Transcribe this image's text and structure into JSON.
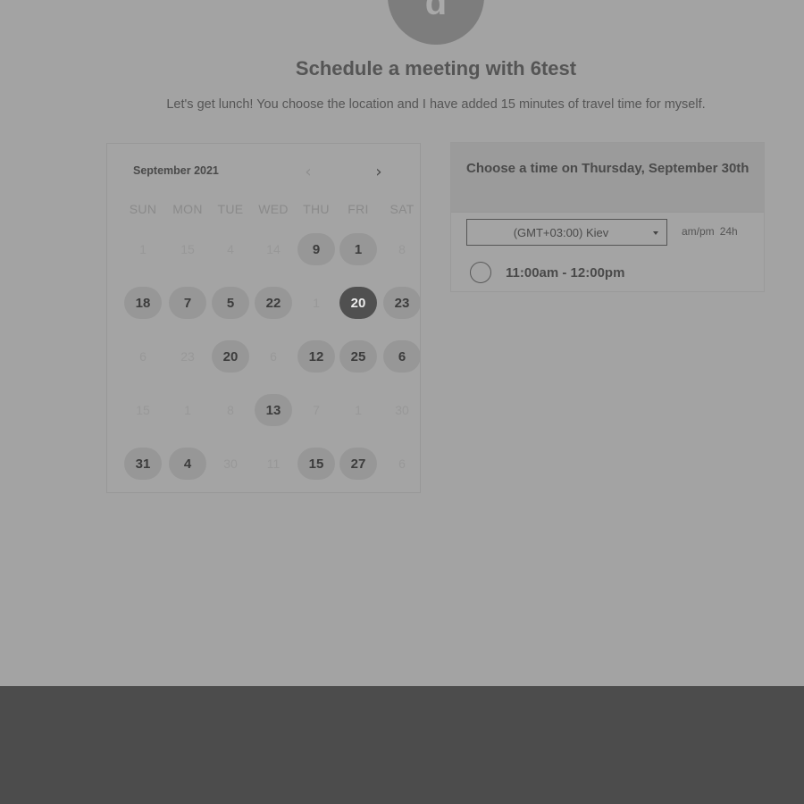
{
  "host": {
    "avatar_letter": "d",
    "title": "Schedule a meeting with 6test",
    "description": "Let's get lunch! You choose the location and I have added 15 minutes of travel time for myself."
  },
  "calendar": {
    "month_label": "September 2021",
    "prev_icon": "chevron-left-icon",
    "next_icon": "chevron-right-icon",
    "weekdays": [
      "SUN",
      "MON",
      "TUE",
      "WED",
      "THU",
      "FRI",
      "SAT"
    ],
    "weeks": [
      [
        {
          "label": "1",
          "state": "disabled"
        },
        {
          "label": "15",
          "state": "disabled"
        },
        {
          "label": "4",
          "state": "disabled"
        },
        {
          "label": "14",
          "state": "disabled"
        },
        {
          "label": "9",
          "state": "available"
        },
        {
          "label": "1",
          "state": "available"
        },
        {
          "label": "8",
          "state": "disabled"
        }
      ],
      [
        {
          "label": "18",
          "state": "available"
        },
        {
          "label": "7",
          "state": "available"
        },
        {
          "label": "5",
          "state": "available"
        },
        {
          "label": "22",
          "state": "available"
        },
        {
          "label": "1",
          "state": "disabled"
        },
        {
          "label": "20",
          "state": "selected"
        },
        {
          "label": "23",
          "state": "available"
        }
      ],
      [
        {
          "label": "6",
          "state": "disabled"
        },
        {
          "label": "23",
          "state": "disabled"
        },
        {
          "label": "20",
          "state": "available"
        },
        {
          "label": "6",
          "state": "disabled"
        },
        {
          "label": "12",
          "state": "available"
        },
        {
          "label": "25",
          "state": "available"
        },
        {
          "label": "6",
          "state": "available"
        }
      ],
      [
        {
          "label": "15",
          "state": "disabled"
        },
        {
          "label": "1",
          "state": "disabled"
        },
        {
          "label": "8",
          "state": "disabled"
        },
        {
          "label": "13",
          "state": "available"
        },
        {
          "label": "7",
          "state": "disabled"
        },
        {
          "label": "1",
          "state": "disabled"
        },
        {
          "label": "30",
          "state": "disabled"
        }
      ],
      [
        {
          "label": "31",
          "state": "available"
        },
        {
          "label": "4",
          "state": "available"
        },
        {
          "label": "30",
          "state": "disabled"
        },
        {
          "label": "11",
          "state": "disabled"
        },
        {
          "label": "15",
          "state": "available"
        },
        {
          "label": "27",
          "state": "available"
        },
        {
          "label": "6",
          "state": "disabled"
        }
      ]
    ]
  },
  "times": {
    "heading": "Choose a time on Thursday, September 30th",
    "timezone": "(GMT+03:00) Kiev",
    "format_12h": "am/pm",
    "format_24h": "24h",
    "slots": [
      "11:00am - 12:00pm"
    ]
  }
}
